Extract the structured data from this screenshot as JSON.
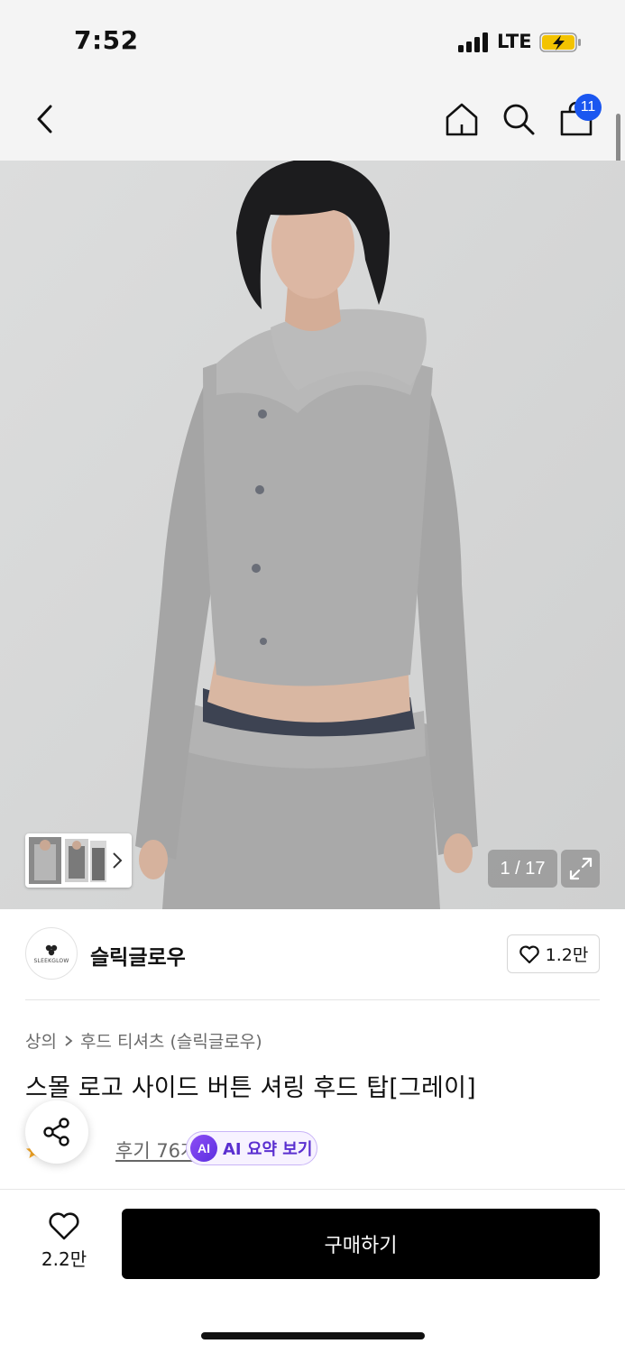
{
  "status_bar": {
    "time": "7:52",
    "network": "LTE"
  },
  "header": {
    "cart_count": "11"
  },
  "gallery": {
    "counter": "1 / 17",
    "thumbnail_count": 3
  },
  "brand": {
    "name": "슬릭글로우",
    "logo_text": "SLEEKGLOW",
    "likes": "1.2만"
  },
  "product": {
    "breadcrumb": [
      "상의",
      "후드 티셔츠 (슬릭글로우)"
    ],
    "title": "스몰 로고 사이드 버튼 셔링 후드 탑[그레이]",
    "reviews": "후기 76개",
    "ai_badge": "AI",
    "ai_summary": "AI 요약 보기"
  },
  "bottom_bar": {
    "likes": "2.2만",
    "buy_label": "구매하기"
  },
  "colors": {
    "accent_blue": "#1a56f0",
    "ai_purple": "#5a2fd0",
    "buy_button": "#000000"
  }
}
